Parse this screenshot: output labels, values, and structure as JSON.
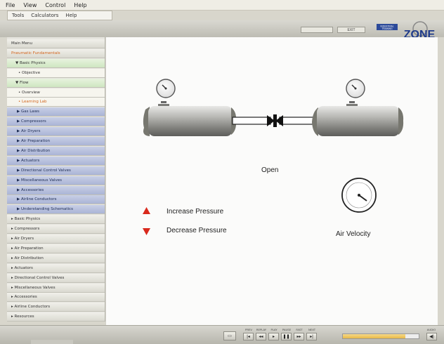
{
  "menubar": {
    "items": [
      "File",
      "View",
      "Control",
      "Help"
    ]
  },
  "submenu": {
    "items": [
      "Tools",
      "Calculators",
      "Help"
    ]
  },
  "topbar": {
    "btn_left": "",
    "btn_exit": "EXIT"
  },
  "sidebar": {
    "items": [
      {
        "label": "Main Menu",
        "style": "level0"
      },
      {
        "label": "Pneumatic Fundamentals",
        "style": "level0 active"
      },
      {
        "label": "▼ Basic Physics",
        "style": "level1"
      },
      {
        "label": "• Objective",
        "style": "level2"
      },
      {
        "label": "▼ Flow",
        "style": "level1"
      },
      {
        "label": "• Overview",
        "style": "level2"
      },
      {
        "label": "• Learning Lab",
        "style": "level2 selected"
      },
      {
        "label": "▶ Gas Laws",
        "style": "blue"
      },
      {
        "label": "▶ Compressors",
        "style": "blue"
      },
      {
        "label": "▶ Air Dryers",
        "style": "blue"
      },
      {
        "label": "▶ Air Preparation",
        "style": "blue"
      },
      {
        "label": "▶ Air Distribution",
        "style": "blue"
      },
      {
        "label": "▶ Actuators",
        "style": "blue"
      },
      {
        "label": "▶ Directional Control Valves",
        "style": "blue"
      },
      {
        "label": "▶ Miscellaneous Valves",
        "style": "blue"
      },
      {
        "label": "▶ Accessories",
        "style": "blue"
      },
      {
        "label": "▶ Airline Conductors",
        "style": "blue"
      },
      {
        "label": "▶ Understanding Schematics",
        "style": "blue"
      },
      {
        "label": "▸ Basic Physics",
        "style": "level0"
      },
      {
        "label": "▸ Compressors",
        "style": "level0"
      },
      {
        "label": "▸ Air Dryers",
        "style": "level0"
      },
      {
        "label": "▸ Air Preparation",
        "style": "level0"
      },
      {
        "label": "▸ Air Distribution",
        "style": "level0"
      },
      {
        "label": "▸ Actuators",
        "style": "level0"
      },
      {
        "label": "▸ Directional Control Valves",
        "style": "level0"
      },
      {
        "label": "▸ Miscellaneous Valves",
        "style": "level0"
      },
      {
        "label": "▸ Accessories",
        "style": "level0"
      },
      {
        "label": "▸ Airline Conductors",
        "style": "level0"
      },
      {
        "label": "▸ Resources",
        "style": "level0"
      }
    ]
  },
  "canvas": {
    "valve_state": "Open",
    "increase_label": "Increase Pressure",
    "decrease_label": "Decrease Pressure",
    "air_velocity_label": "Air Velocity",
    "accent_red": "#d9291c"
  },
  "controls": {
    "labels": [
      "PREV",
      "REPLAY",
      "PLAY",
      "PAUSE",
      "FAST",
      "NEXT"
    ],
    "audio_label": "AUDIO",
    "progress": 0.82,
    "progress_color": "#e8b946"
  },
  "logo": {
    "line1": "INDUSTRIAL",
    "line2": "TRAINING",
    "word": "ZONE"
  }
}
